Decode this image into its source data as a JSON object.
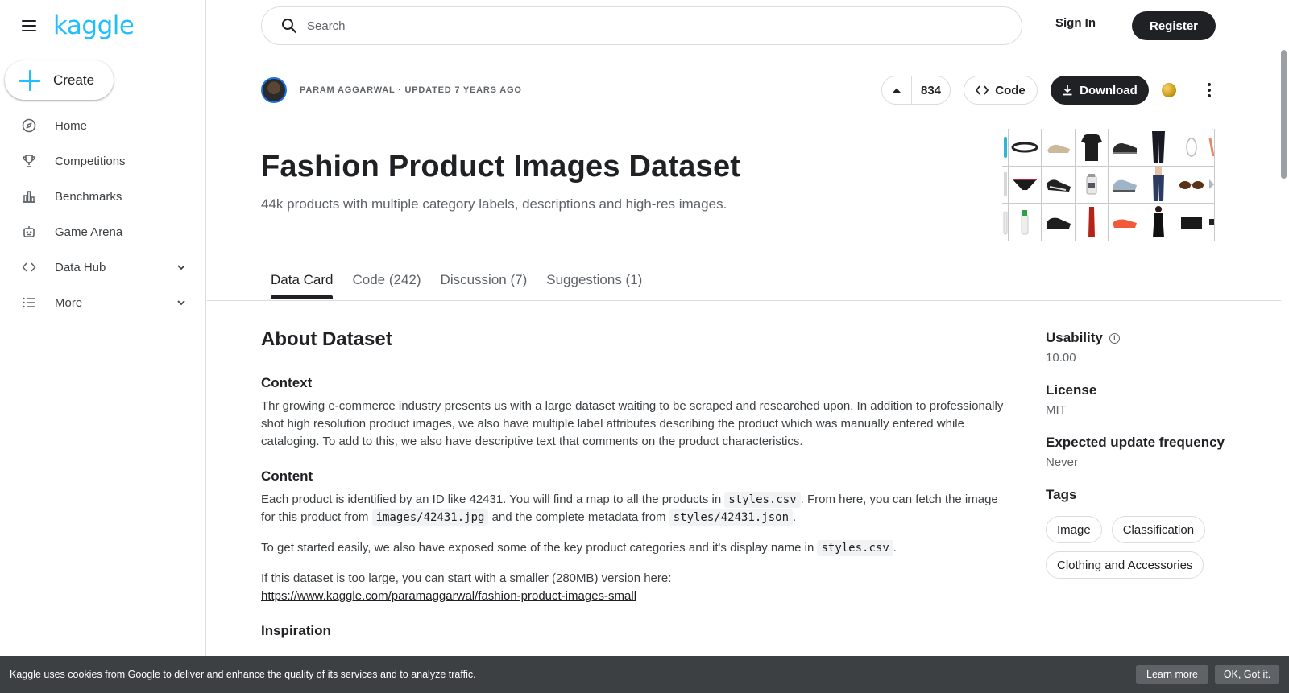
{
  "brand": {
    "logo_text": "kaggle",
    "logo_color": "#20beff"
  },
  "sidebar": {
    "create_label": "Create",
    "items": [
      {
        "label": "Home",
        "icon": "compass-icon"
      },
      {
        "label": "Competitions",
        "icon": "trophy-icon"
      },
      {
        "label": "Benchmarks",
        "icon": "bar-chart-icon"
      },
      {
        "label": "Game Arena",
        "icon": "robot-icon"
      },
      {
        "label": "Data Hub",
        "icon": "code-brackets-icon",
        "expandable": true
      },
      {
        "label": "More",
        "icon": "list-icon",
        "expandable": true
      }
    ]
  },
  "topbar": {
    "search_placeholder": "Search",
    "sign_in": "Sign In",
    "register": "Register"
  },
  "dataset": {
    "author_meta": "PARAM AGGARWAL · UPDATED 7 YEARS AGO",
    "upvotes": "834",
    "code_label": "Code",
    "download_label": "Download",
    "title": "Fashion Product Images Dataset",
    "subtitle": "44k products with multiple category labels, descriptions and high-res images."
  },
  "tabs": [
    {
      "label": "Data Card",
      "active": true
    },
    {
      "label": "Code (242)"
    },
    {
      "label": "Discussion (7)"
    },
    {
      "label": "Suggestions (1)"
    }
  ],
  "content": {
    "about_heading": "About Dataset",
    "context_heading": "Context",
    "context_text": "Thr growing e-commerce industry presents us with a large dataset waiting to be scraped and researched upon. In addition to professionally shot high resolution product images, we also have multiple label attributes describing the product which was manually entered while cataloging. To add to this, we also have descriptive text that comments on the product characteristics.",
    "content_heading": "Content",
    "content_p1_a": "Each product is identified by an ID like 42431. You will find a map to all the products in ",
    "content_p1_code1": "styles.csv",
    "content_p1_b": ". From here, you can fetch the image for this product from ",
    "content_p1_code2": "images/42431.jpg",
    "content_p1_c": " and the complete metadata from ",
    "content_p1_code3": "styles/42431.json",
    "content_p1_d": ".",
    "content_p2_a": "To get started easily, we also have exposed some of the key product categories and it's display name in ",
    "content_p2_code": "styles.csv",
    "content_p2_b": ".",
    "content_p3": "If this dataset is too large, you can start with a smaller (280MB) version here:",
    "content_p3_link": "https://www.kaggle.com/paramaggarwal/fashion-product-images-small",
    "inspiration_heading": "Inspiration"
  },
  "meta": {
    "usability_label": "Usability",
    "usability_value": "10.00",
    "license_label": "License",
    "license_value": "MIT",
    "frequency_label": "Expected update frequency",
    "frequency_value": "Never",
    "tags_label": "Tags",
    "tags": [
      "Image",
      "Classification",
      "Clothing and Accessories"
    ]
  },
  "cookie": {
    "text": "Kaggle uses cookies from Google to deliver and enhance the quality of its services and to analyze traffic.",
    "learn_more": "Learn more",
    "ok": "OK, Got it."
  }
}
